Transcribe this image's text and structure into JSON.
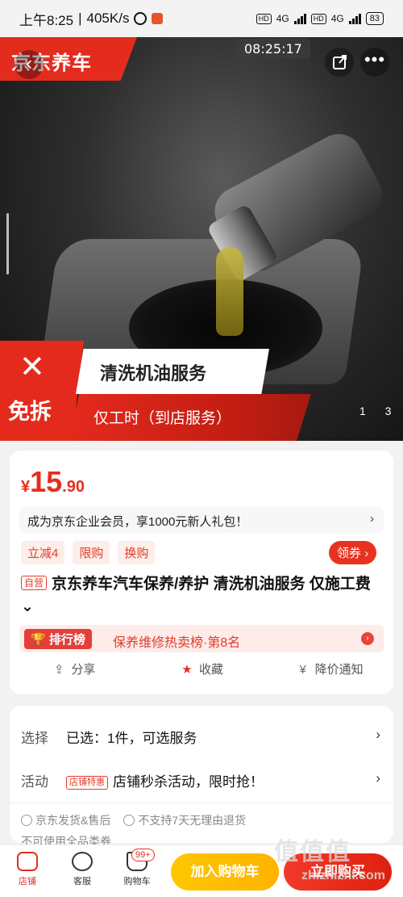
{
  "status_bar": {
    "time": "上午8:25",
    "speed": "405K/s",
    "battery": "83",
    "network1": "4G",
    "network2": "4G",
    "hd": "HD"
  },
  "hero": {
    "brand": "京东养车",
    "timer": "08:25:17",
    "banner_label": "免拆",
    "banner_title": "清洗机油服务",
    "banner_subtitle": "仅工时（到店服务）",
    "page_indicator": "1  3"
  },
  "product": {
    "currency": "¥",
    "price_int": "15",
    "price_dec": ".90",
    "promo": "成为京东企业会员，享1000元新人礼包！",
    "tags": [
      "立减4",
      "限购",
      "换购"
    ],
    "coupon_button": "领券",
    "self_tag": "自营",
    "title": "京东养车汽车保养/养护 清洗机油服务 仅施工费",
    "rank_badge": "排行榜",
    "rank_text": "保养维修热卖榜·第8名",
    "actions": {
      "share": "分享",
      "favorite": "收藏",
      "price_alert": "降价通知"
    }
  },
  "selection": {
    "select_label": "选择",
    "select_value": "已选：1件，可选服务",
    "activity_label": "活动",
    "activity_tag": "店铺特惠",
    "activity_value": "店铺秒杀活动，限时抢！",
    "service1": "京东发货&售后",
    "service2": "不支持7天无理由退货",
    "service3": "不可使用全品类券"
  },
  "bottom_bar": {
    "store": "店铺",
    "service": "客服",
    "cart": "购物车",
    "cart_badge": "99+",
    "add_to_cart": "加入购物车",
    "buy_now": "立即购买"
  },
  "watermark": {
    "text": "值值值",
    "url": "zhizhizhi.com"
  },
  "colors": {
    "accent": "#e62e1e",
    "cart_button": "#ffc700"
  }
}
